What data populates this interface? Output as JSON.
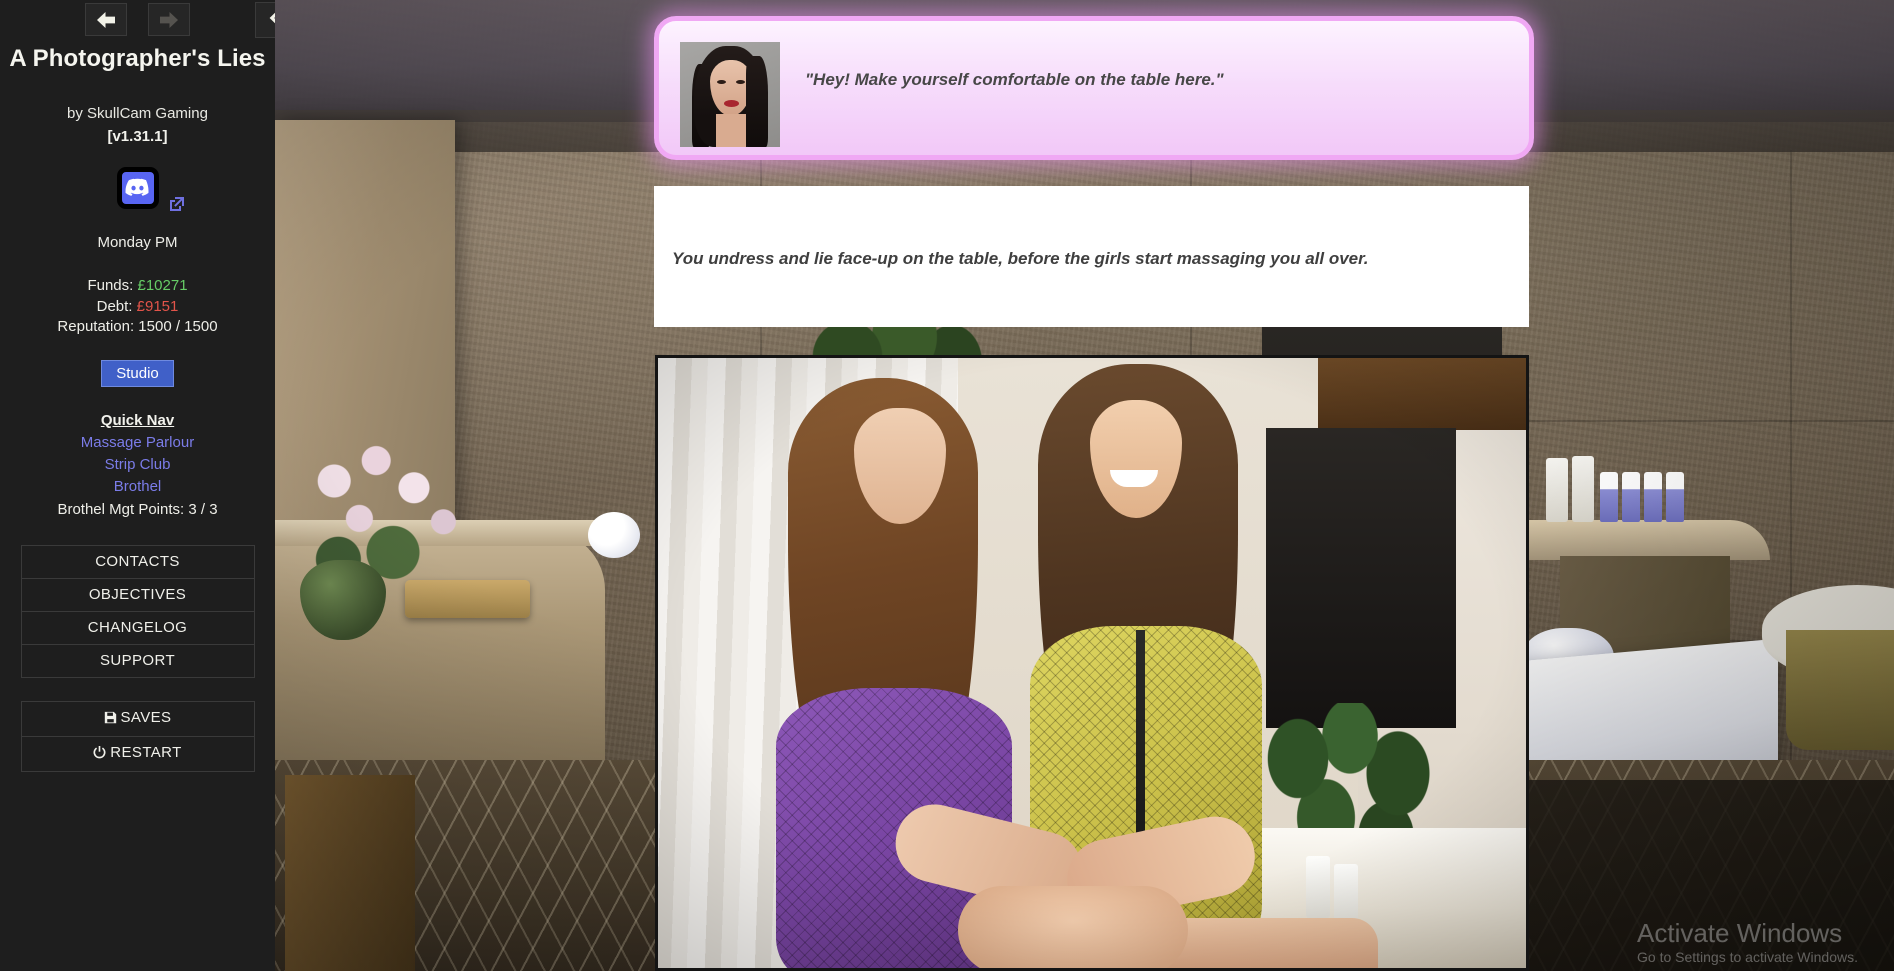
{
  "sidebar": {
    "nav": {
      "back_icon": "arrow-left-icon",
      "forward_icon": "arrow-right-icon",
      "collapse_icon": "chevron-left-icon"
    },
    "title": "A Photographer's Lies",
    "author": "by SkullCam Gaming",
    "version": "[v1.31.1]",
    "discord": {
      "icon": "discord-icon",
      "external_icon": "external-link-icon"
    },
    "daytime": "Monday PM",
    "stats": {
      "funds_label": "Funds:",
      "funds_value": "£10271",
      "funds_color": "#66cc66",
      "debt_label": "Debt:",
      "debt_value": "£9151",
      "debt_color": "#e2544a",
      "reputation": "Reputation: 1500 / 1500"
    },
    "studio_button": "Studio",
    "quicknav": {
      "title": "Quick Nav",
      "links": [
        {
          "label": "Massage Parlour"
        },
        {
          "label": "Strip Club"
        },
        {
          "label": "Brothel"
        }
      ],
      "mgt_points": "Brothel Mgt Points: 3 / 3",
      "link_color": "#7b7ce8"
    },
    "menu": [
      {
        "label": "CONTACTS",
        "icon": null
      },
      {
        "label": "OBJECTIVES",
        "icon": null
      },
      {
        "label": "CHANGELOG",
        "icon": null
      },
      {
        "label": "SUPPORT",
        "icon": null
      }
    ],
    "system_menu": [
      {
        "label": "SAVES",
        "icon": "floppy-disk-icon",
        "glyph": "💾"
      },
      {
        "label": "RESTART",
        "icon": "power-icon",
        "glyph": "⏻"
      }
    ]
  },
  "dialogue": {
    "speaker_portrait_alt": "female-character-portrait",
    "text": "\"Hey! Make yourself comfortable on the table here.\"",
    "border_color": "#f0a8f4",
    "background_color": "#f6dcfb"
  },
  "narration": {
    "text": "You undress and lie face-up on the table, before the girls start massaging you all over.",
    "background_color": "#ffffff"
  },
  "scene_image": {
    "alt": "two-women-massaging-client-photo"
  },
  "watermark": {
    "line1": "Activate Windows",
    "line2": "Go to Settings to activate Windows."
  }
}
